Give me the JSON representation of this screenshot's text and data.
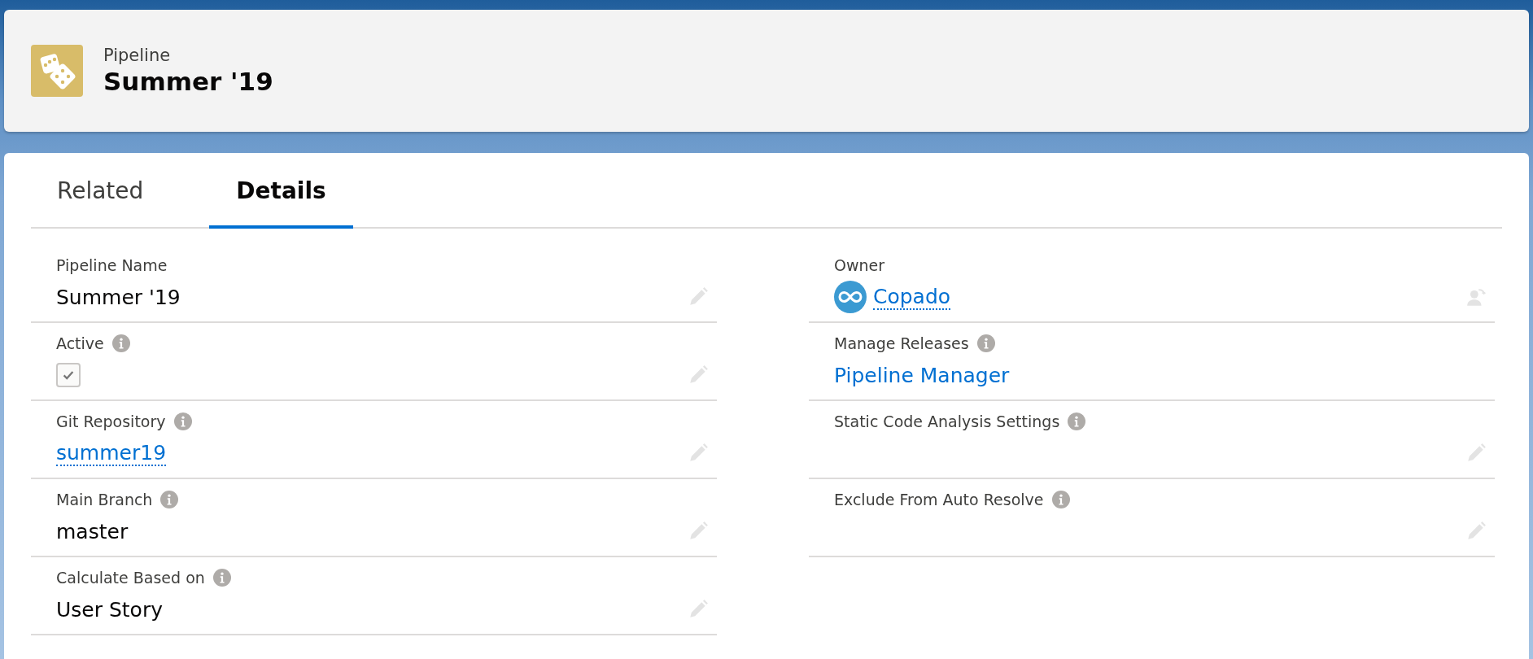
{
  "header": {
    "object_type": "Pipeline",
    "title": "Summer '19"
  },
  "tabs": [
    {
      "label": "Related",
      "selected": false
    },
    {
      "label": "Details",
      "selected": true
    }
  ],
  "columns": [
    [
      {
        "label": "Pipeline Name",
        "info": false,
        "kind": "text",
        "value": "Summer '19",
        "editable": true
      },
      {
        "label": "Active",
        "info": true,
        "kind": "checkbox",
        "checked": true,
        "editable": true
      },
      {
        "label": "Git Repository",
        "info": true,
        "kind": "link",
        "value": "summer19",
        "editable": true
      },
      {
        "label": "Main Branch",
        "info": true,
        "kind": "text",
        "value": "master",
        "editable": true
      },
      {
        "label": "Calculate Based on",
        "info": true,
        "kind": "text",
        "value": "User Story",
        "editable": true
      }
    ],
    [
      {
        "label": "Owner",
        "info": false,
        "kind": "owner",
        "value": "Copado",
        "editable": true
      },
      {
        "label": "Manage Releases",
        "info": true,
        "kind": "plain-link",
        "value": "Pipeline Manager",
        "editable": false
      },
      {
        "label": "Static Code Analysis Settings",
        "info": true,
        "kind": "empty",
        "editable": true
      },
      {
        "label": "Exclude From Auto Resolve",
        "info": true,
        "kind": "empty",
        "editable": true
      }
    ]
  ]
}
